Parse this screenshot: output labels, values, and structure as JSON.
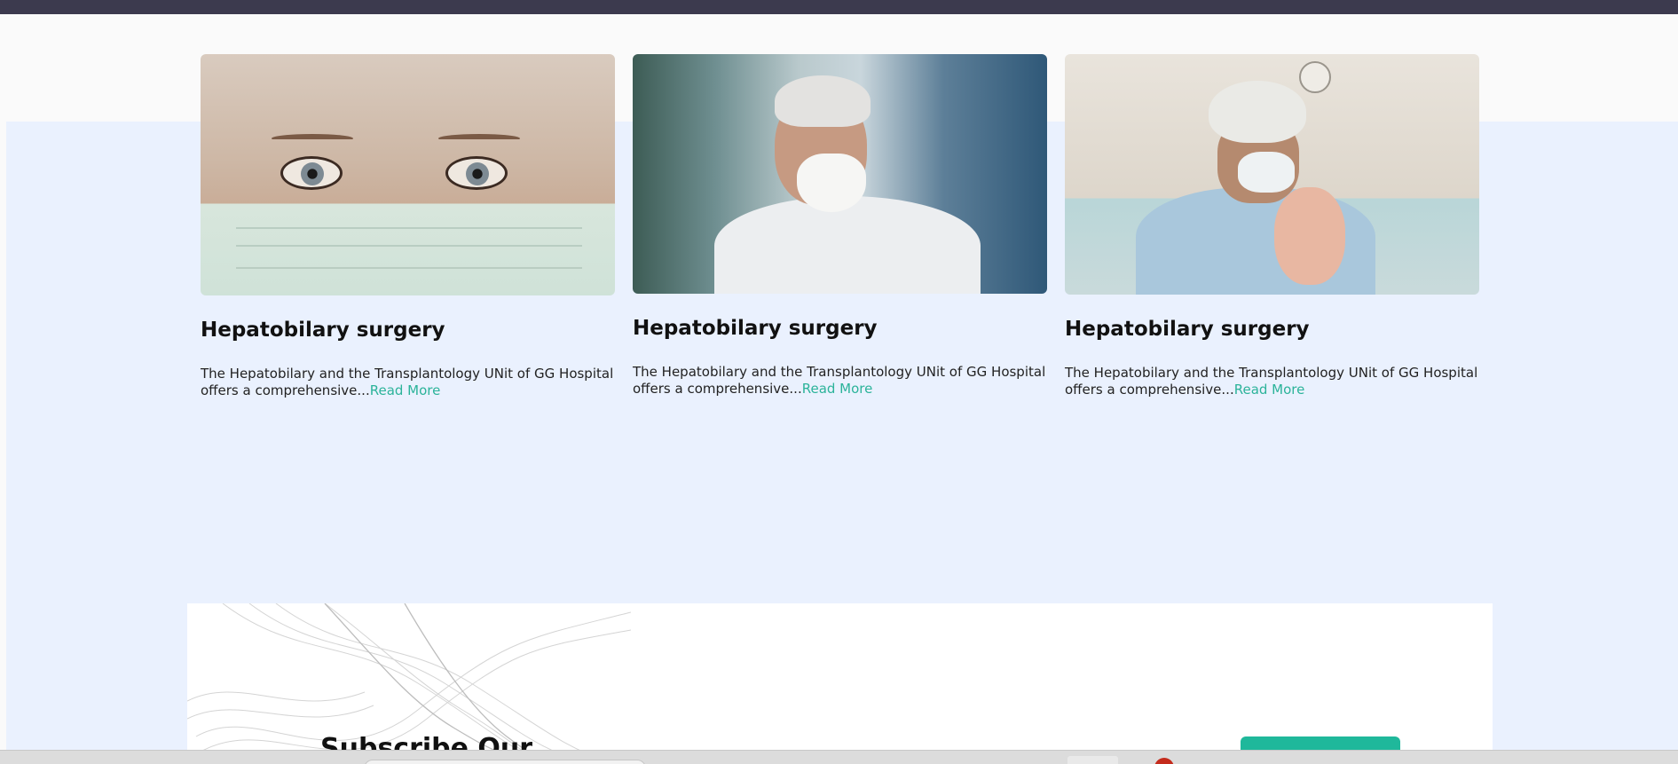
{
  "cards": [
    {
      "title": "Hepatobilary surgery",
      "excerpt": "The Hepatobilary and the Transplantology UNit of GG Hospital offers a comprehensive...",
      "link_label": "Read More",
      "image": "nurse-eyes-with-mask-photo"
    },
    {
      "title": "Hepatobilary surgery",
      "excerpt": "The Hepatobilary and the Transplantology UNit of GG Hospital offers a comprehensive...",
      "link_label": "Read More",
      "image": "man-wearing-mask-photo"
    },
    {
      "title": "Hepatobilary surgery",
      "excerpt": "The Hepatobilary and the Transplantology UNit of GG Hospital offers a comprehensive...",
      "link_label": "Read More",
      "image": "doctor-holding-newborn-photo"
    }
  ],
  "subscribe": {
    "title": "Subscribe Our"
  },
  "colors": {
    "accent": "#2bb39a",
    "button": "#1fb89b",
    "section_bg": "#eaf1fe",
    "topbar": "#3c3a4e"
  }
}
